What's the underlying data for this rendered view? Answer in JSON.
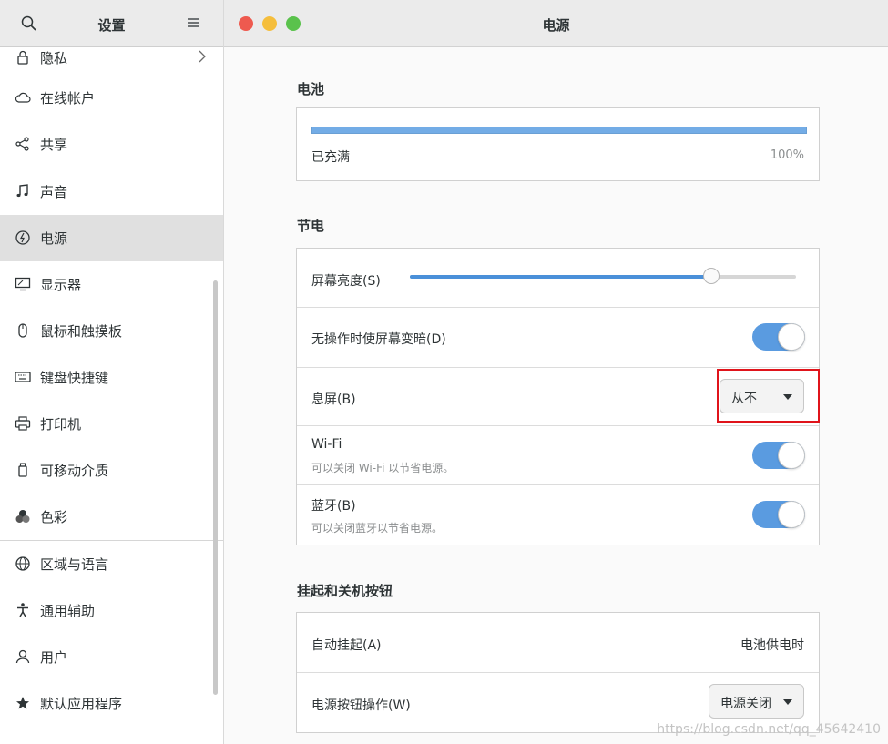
{
  "sidebar": {
    "title": "设置",
    "icons": {
      "search": "search-icon",
      "menu": "menu-icon"
    },
    "items": [
      {
        "label": "隐私",
        "icon": "lock-icon",
        "chevron": true
      },
      {
        "label": "在线帐户",
        "icon": "cloud-icon"
      },
      {
        "label": "共享",
        "icon": "share-icon"
      },
      {
        "label": "声音",
        "icon": "music-note-icon"
      },
      {
        "label": "电源",
        "icon": "power-icon",
        "active": true
      },
      {
        "label": "显示器",
        "icon": "display-icon"
      },
      {
        "label": "鼠标和触摸板",
        "icon": "mouse-icon"
      },
      {
        "label": "键盘快捷键",
        "icon": "keyboard-icon"
      },
      {
        "label": "打印机",
        "icon": "printer-icon"
      },
      {
        "label": "可移动介质",
        "icon": "removable-media-icon"
      },
      {
        "label": "色彩",
        "icon": "color-icon"
      },
      {
        "label": "区域与语言",
        "icon": "globe-icon"
      },
      {
        "label": "通用辅助",
        "icon": "accessibility-icon"
      },
      {
        "label": "用户",
        "icon": "user-icon"
      },
      {
        "label": "默认应用程序",
        "icon": "star-icon"
      }
    ]
  },
  "header": {
    "title": "电源"
  },
  "battery": {
    "section_title": "电池",
    "level": 1.0,
    "status": "已充满",
    "percent": "100%"
  },
  "power_saving": {
    "section_title": "节电",
    "brightness_label": "屏幕亮度(S)",
    "brightness_level": 0.78,
    "dim_label": "无操作时使屏幕变暗(D)",
    "dim_on": true,
    "blank_label": "息屏(B)",
    "blank_value": "从不",
    "wifi_label": "Wi-Fi",
    "wifi_sub": "可以关闭 Wi-Fi 以节省电源。",
    "wifi_on": true,
    "bt_label": "蓝牙(B)",
    "bt_sub": "可以关闭蓝牙以节省电源。",
    "bt_on": true
  },
  "suspend": {
    "section_title": "挂起和关机按钮",
    "auto_label": "自动挂起(A)",
    "auto_value": "电池供电时",
    "button_label": "电源按钮操作(W)",
    "button_value": "电源关闭"
  },
  "colors": {
    "accent": "#4a90d9",
    "highlight": "#e0141b",
    "close": "#ee5a4f",
    "minimize": "#f5be3c",
    "maximize": "#5ac24c"
  },
  "watermark": "https://blog.csdn.net/qq_45642410"
}
